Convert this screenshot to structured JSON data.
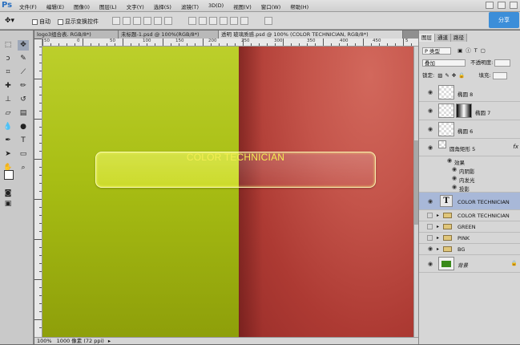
{
  "app": {
    "logo": "Ps"
  },
  "menu": [
    "文件(F)",
    "编辑(E)",
    "图像(I)",
    "图层(L)",
    "文字(Y)",
    "选择(S)",
    "滤镜(T)",
    "3D(D)",
    "视图(V)",
    "窗口(W)",
    "帮助(H)"
  ],
  "options": {
    "auto_select": "自动",
    "show_transform": "显示变换控件"
  },
  "share": {
    "label": "分享"
  },
  "tabs": [
    {
      "label": "logo3组合表. RGB/8*)"
    },
    {
      "label": "未标题-1.psd @ 100%(RGB/8*)"
    },
    {
      "label": "透明 玻璃质感.psd @ 100% (COLOR TECHNICIAN, RGB/8*)"
    }
  ],
  "ruler": {
    "top": [
      "50",
      "0",
      "50",
      "100",
      "150",
      "200",
      "250",
      "300",
      "350",
      "400",
      "450",
      "5"
    ]
  },
  "canvas": {
    "button_text": "COLOR TECHNICIAN"
  },
  "status": {
    "zoom": "100%",
    "doc": "1000 像素 (72 ppi)"
  },
  "panel": {
    "tabs": [
      "图层",
      "通道",
      "路径"
    ],
    "filter": "P 类型",
    "blend": "叠加",
    "opacity_label": "不透明度:",
    "lock_label": "锁定:",
    "fill_label": "填充:",
    "layers": [
      {
        "name": "椭圆 8",
        "type": "shape"
      },
      {
        "name": "椭圆 7",
        "type": "shape-mask"
      },
      {
        "name": "椭圆 6",
        "type": "shape"
      },
      {
        "name": "圆角矩形 5",
        "type": "shape",
        "fx": "fx"
      },
      {
        "name": "效果",
        "type": "effect-header"
      },
      {
        "name": "内阴影",
        "type": "effect"
      },
      {
        "name": "内发光",
        "type": "effect"
      },
      {
        "name": "投影",
        "type": "effect"
      },
      {
        "name": "COLOR TECHNICIAN",
        "type": "text",
        "selected": true
      },
      {
        "name": "COLOR TECHNICIAN",
        "type": "group"
      },
      {
        "name": "GREEN",
        "type": "group"
      },
      {
        "name": "PINK",
        "type": "group"
      },
      {
        "name": "BG",
        "type": "group"
      },
      {
        "name": "背景",
        "type": "background"
      }
    ]
  },
  "colors": {
    "green": "#a8be14",
    "red": "#c4544a",
    "text": "#f4ee52",
    "accent": "#3c8ed9"
  }
}
